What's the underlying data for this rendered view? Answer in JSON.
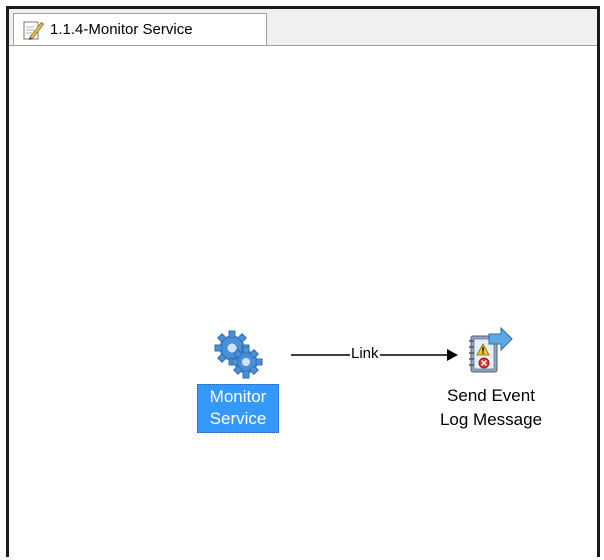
{
  "tab": {
    "title": "1.1.4-Monitor Service",
    "icon": "pencil-document-icon"
  },
  "nodes": {
    "monitor": {
      "line1": "Monitor",
      "line2": "Service",
      "icon": "gear-icon"
    },
    "send": {
      "line1": "Send Event",
      "line2": "Log Message",
      "icon": "event-log-send-icon"
    }
  },
  "link": {
    "label": "Link"
  },
  "colors": {
    "selection": "#3399ff",
    "gear": "#4a90d9"
  }
}
